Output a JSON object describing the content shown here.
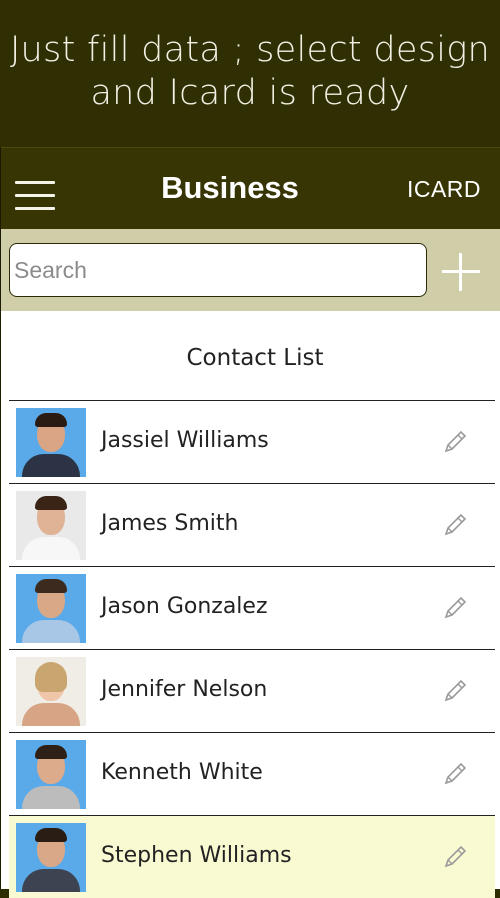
{
  "promo": {
    "line1": "Just fill data ;  select design",
    "line2": "and Icard is ready"
  },
  "appbar": {
    "title": "Business",
    "action": "ICARD"
  },
  "search": {
    "placeholder": "Search",
    "value": ""
  },
  "list": {
    "title": "Contact List",
    "contacts": [
      {
        "name": "Jassiel Williams"
      },
      {
        "name": "James Smith"
      },
      {
        "name": "Jason Gonzalez"
      },
      {
        "name": "Jennifer Nelson"
      },
      {
        "name": "Kenneth White"
      },
      {
        "name": "Stephen Williams"
      }
    ]
  },
  "colors": {
    "appbar": "#363503",
    "promo_bg": "#302f03",
    "search_bar": "#cfcea9",
    "highlight_row": "#fafad2",
    "avatar_bg": "#5aa9e8"
  },
  "icons": {
    "menu": "hamburger-menu-icon",
    "add": "plus-icon",
    "edit": "pencil-icon"
  }
}
